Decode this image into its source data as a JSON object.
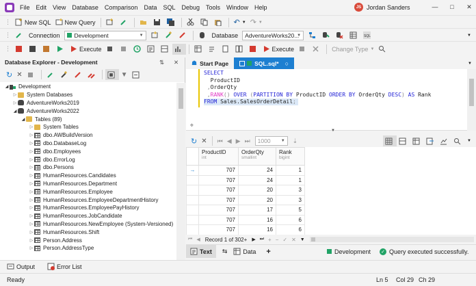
{
  "menu": [
    "File",
    "Edit",
    "View",
    "Database",
    "Comparison",
    "Data",
    "SQL",
    "Debug",
    "Tools",
    "Window",
    "Help"
  ],
  "user": {
    "initials": "JS",
    "name": "Jordan Sanders"
  },
  "toolbar1": {
    "new_sql": "New SQL",
    "new_query": "New Query"
  },
  "toolbar2": {
    "connection_label": "Connection",
    "connection_value": "Development",
    "database_label": "Database",
    "database_value": "AdventureWorks20..."
  },
  "toolbar3": {
    "execute_left": "Execute",
    "execute_right": "Execute",
    "change_type": "Change Type"
  },
  "explorer": {
    "title": "Database Explorer - Development",
    "tree": [
      {
        "label": "Development",
        "level": 0,
        "icon": "connection-icon",
        "expanded": true
      },
      {
        "label": "System Databases",
        "level": 1,
        "icon": "folder-icon",
        "expanded": false
      },
      {
        "label": "AdventureWorks2019",
        "level": 1,
        "icon": "database-icon",
        "expanded": false
      },
      {
        "label": "AdventureWorks2022",
        "level": 1,
        "icon": "database-icon",
        "expanded": true
      },
      {
        "label": "Tables (89)",
        "level": 2,
        "icon": "folder-icon",
        "expanded": true
      },
      {
        "label": "System Tables",
        "level": 3,
        "icon": "folder-icon",
        "expanded": false
      },
      {
        "label": "dbo.AWBuildVersion",
        "level": 3,
        "icon": "table-icon",
        "expanded": false
      },
      {
        "label": "dbo.DatabaseLog",
        "level": 3,
        "icon": "table-icon",
        "expanded": false
      },
      {
        "label": "dbo.Employees",
        "level": 3,
        "icon": "table-icon",
        "expanded": false
      },
      {
        "label": "dbo.ErrorLog",
        "level": 3,
        "icon": "table-icon",
        "expanded": false
      },
      {
        "label": "dbo.Persons",
        "level": 3,
        "icon": "table-icon",
        "expanded": false
      },
      {
        "label": "HumanResources.Candidates",
        "level": 3,
        "icon": "table-icon",
        "expanded": false
      },
      {
        "label": "HumanResources.Department",
        "level": 3,
        "icon": "table-icon",
        "expanded": false
      },
      {
        "label": "HumanResources.Employee",
        "level": 3,
        "icon": "table-icon",
        "expanded": false
      },
      {
        "label": "HumanResources.EmployeeDepartmentHistory",
        "level": 3,
        "icon": "table-icon",
        "expanded": false
      },
      {
        "label": "HumanResources.EmployeePayHistory",
        "level": 3,
        "icon": "table-icon",
        "expanded": false
      },
      {
        "label": "HumanResources.JobCandidate",
        "level": 3,
        "icon": "table-icon",
        "expanded": false
      },
      {
        "label": "HumanResources.NewEmployee (System-Versioned)",
        "level": 3,
        "icon": "table-icon",
        "expanded": false
      },
      {
        "label": "HumanResources.Shift",
        "level": 3,
        "icon": "table-icon",
        "expanded": false
      },
      {
        "label": "Person.Address",
        "level": 3,
        "icon": "table-icon",
        "expanded": false
      },
      {
        "label": "Person.AddressType",
        "level": 3,
        "icon": "table-icon",
        "expanded": false
      }
    ]
  },
  "tabs": {
    "start_page": "Start Page",
    "sql_tab": "SQL.sql*"
  },
  "editor": {
    "lines": [
      [
        {
          "t": "SELECT",
          "c": "kw"
        }
      ],
      [
        {
          "t": "  ProductID",
          "c": "id"
        }
      ],
      [
        {
          "t": " ,",
          "c": "op"
        },
        {
          "t": "OrderQty",
          "c": "id"
        }
      ],
      [
        {
          "t": " ,",
          "c": "op"
        },
        {
          "t": "RANK",
          "c": "fn"
        },
        {
          "t": "() ",
          "c": "op"
        },
        {
          "t": "OVER",
          "c": "kw"
        },
        {
          "t": " (",
          "c": "op"
        },
        {
          "t": "PARTITION BY",
          "c": "kw"
        },
        {
          "t": " ProductID ",
          "c": "id"
        },
        {
          "t": "ORDER BY",
          "c": "kw"
        },
        {
          "t": " OrderQty ",
          "c": "id"
        },
        {
          "t": "DESC",
          "c": "kw"
        },
        {
          "t": ") ",
          "c": "op"
        },
        {
          "t": "AS",
          "c": "kw"
        },
        {
          "t": " Rank",
          "c": "id"
        }
      ],
      [
        {
          "t": "FROM",
          "c": "kw"
        },
        {
          "t": " Sales.SalesOrderDetail",
          "c": "id"
        },
        {
          "t": ";",
          "c": "op"
        }
      ]
    ]
  },
  "grid_toolbar": {
    "page_size": "1000"
  },
  "grid": {
    "columns": [
      {
        "name": "ProductID",
        "type": "int"
      },
      {
        "name": "OrderQty",
        "type": "smallint"
      },
      {
        "name": "Rank",
        "type": "bigint"
      }
    ],
    "rows": [
      [
        "707",
        "24",
        "1"
      ],
      [
        "707",
        "24",
        "1"
      ],
      [
        "707",
        "20",
        "3"
      ],
      [
        "707",
        "20",
        "3"
      ],
      [
        "707",
        "17",
        "5"
      ],
      [
        "707",
        "16",
        "6"
      ],
      [
        "707",
        "16",
        "6"
      ]
    ],
    "record_text": "Record 1 of 302+"
  },
  "bottom_tabs": {
    "text": "Text",
    "data": "Data",
    "add": "+",
    "connection": "Development",
    "status": "Query executed successfully."
  },
  "output_bar": {
    "output": "Output",
    "error_list": "Error List"
  },
  "statusbar": {
    "ready": "Ready",
    "ln": "Ln 5",
    "col": "Col 29",
    "ch": "Ch 29"
  },
  "colors": {
    "accent": "#1d7fd1",
    "green": "#21a366",
    "logo": "#8a3ab9"
  }
}
